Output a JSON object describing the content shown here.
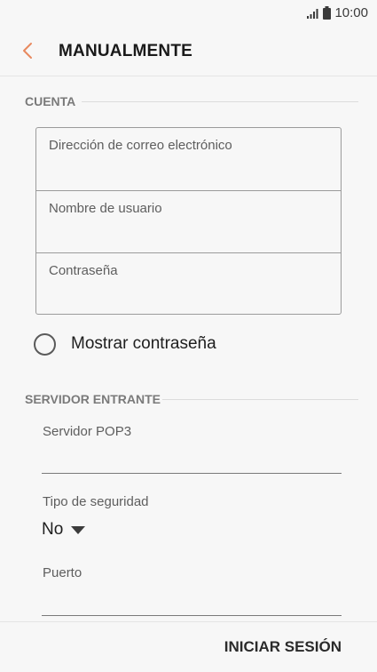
{
  "status_bar": {
    "time": "10:00"
  },
  "app_bar": {
    "title": "MANUALMENTE",
    "back_icon": "chevron-left-icon",
    "accent_color": "#e8895f"
  },
  "account_section": {
    "header": "CUENTA",
    "email_placeholder": "Dirección de correo electrónico",
    "username_placeholder": "Nombre de usuario",
    "password_placeholder": "Contraseña",
    "show_password_label": "Mostrar contraseña"
  },
  "incoming_section": {
    "header": "SERVIDOR ENTRANTE",
    "server_label": "Servidor POP3",
    "security_label": "Tipo de seguridad",
    "security_value": "No",
    "port_label": "Puerto"
  },
  "footer": {
    "signin_label": "INICIAR SESIÓN"
  }
}
